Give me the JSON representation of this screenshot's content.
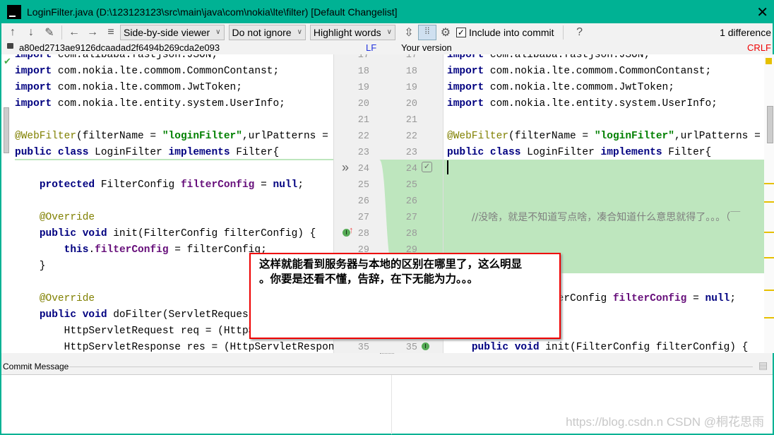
{
  "window": {
    "title": "LoginFilter.java (D:\\123123123\\src\\main\\java\\com\\nokia\\lte\\filter) [Default Changelist]",
    "logo": "IJ"
  },
  "toolbar": {
    "viewer": "Side-by-side viewer",
    "ignore": "Do not ignore",
    "highlight": "Highlight words",
    "include_label": "Include into commit",
    "include_checked": true,
    "help": "?",
    "differences": "1 difference"
  },
  "info": {
    "left_revision": "a80ed2713ae9126dcaadad2f6494b269cda2e093",
    "left_separator": "LF",
    "right_title": "Your version",
    "right_separator": "CRLF"
  },
  "left_lines": [
    {
      "n": "17",
      "t": [
        [
          "import",
          "kw"
        ],
        [
          " com.alibaba.fastjson.JSON;",
          ""
        ]
      ]
    },
    {
      "n": "18",
      "t": [
        [
          "import",
          "kw"
        ],
        [
          " com.nokia.lte.commom.CommonContanst;",
          ""
        ]
      ]
    },
    {
      "n": "19",
      "t": [
        [
          "import",
          "kw"
        ],
        [
          " com.nokia.lte.commom.JwtToken;",
          ""
        ]
      ]
    },
    {
      "n": "20",
      "t": [
        [
          "import",
          "kw"
        ],
        [
          " com.nokia.lte.entity.system.UserInfo;",
          ""
        ]
      ]
    },
    {
      "n": "21",
      "t": []
    },
    {
      "n": "22",
      "t": [
        [
          "@WebFilter",
          "ann"
        ],
        [
          "(filterName = ",
          ""
        ],
        [
          "\"loginFilter\"",
          "str"
        ],
        [
          ",urlPatterns = ",
          ""
        ],
        [
          "\"/",
          "str"
        ]
      ]
    },
    {
      "n": "23",
      "t": [
        [
          "public class",
          "kw"
        ],
        [
          " LoginFilter ",
          ""
        ],
        [
          "implements",
          "kw"
        ],
        [
          " Filter{",
          ""
        ]
      ]
    },
    {
      "n": "24",
      "t": []
    },
    {
      "n": "25",
      "t": [
        [
          "    ",
          ""
        ],
        [
          "protected",
          "kw"
        ],
        [
          " FilterConfig ",
          ""
        ],
        [
          "filterConfig",
          "fld"
        ],
        [
          " = ",
          ""
        ],
        [
          "null",
          "kw"
        ],
        [
          ";",
          ""
        ]
      ]
    },
    {
      "n": "26",
      "t": []
    },
    {
      "n": "27",
      "t": [
        [
          "    ",
          ""
        ],
        [
          "@Override",
          "ann"
        ]
      ]
    },
    {
      "n": "28",
      "t": [
        [
          "    ",
          ""
        ],
        [
          "public void",
          "kw"
        ],
        [
          " init(FilterConfig filterConfig) {",
          ""
        ]
      ]
    },
    {
      "n": "29",
      "t": [
        [
          "        ",
          ""
        ],
        [
          "this",
          "kw"
        ],
        [
          ".",
          ""
        ],
        [
          "filterConfig",
          "fld"
        ],
        [
          " = filterConfig;",
          ""
        ]
      ]
    },
    {
      "n": "30",
      "t": [
        [
          "    }",
          ""
        ]
      ]
    },
    {
      "n": "31",
      "t": []
    },
    {
      "n": "32",
      "t": [
        [
          "    ",
          ""
        ],
        [
          "@Override",
          "ann"
        ]
      ]
    },
    {
      "n": "33",
      "t": [
        [
          "    ",
          ""
        ],
        [
          "public void",
          "kw"
        ],
        [
          " doFilter(ServletRequest s",
          ""
        ]
      ]
    },
    {
      "n": "34",
      "t": [
        [
          "        HttpServletRequest req = (HttpServ",
          ""
        ]
      ]
    },
    {
      "n": "35",
      "t": [
        [
          "        HttpServletResponse res = (HttpServletResponse)",
          ""
        ]
      ]
    }
  ],
  "right_lines": [
    {
      "n": "17",
      "t": [
        [
          "import",
          "kw"
        ],
        [
          " com.alibaba.fastjson.JSON;",
          ""
        ]
      ]
    },
    {
      "n": "18",
      "t": [
        [
          "import",
          "kw"
        ],
        [
          " com.nokia.lte.commom.CommonContanst;",
          ""
        ]
      ]
    },
    {
      "n": "19",
      "t": [
        [
          "import",
          "kw"
        ],
        [
          " com.nokia.lte.commom.JwtToken;",
          ""
        ]
      ]
    },
    {
      "n": "20",
      "t": [
        [
          "import",
          "kw"
        ],
        [
          " com.nokia.lte.entity.system.UserInfo;",
          ""
        ]
      ]
    },
    {
      "n": "21",
      "t": []
    },
    {
      "n": "22",
      "t": [
        [
          "@WebFilter",
          "ann"
        ],
        [
          "(filterName = ",
          ""
        ],
        [
          "\"loginFilter\"",
          "str"
        ],
        [
          ",urlPatterns = ",
          ""
        ],
        [
          "\"/*",
          "str"
        ]
      ]
    },
    {
      "n": "23",
      "t": [
        [
          "public class",
          "kw"
        ],
        [
          " LoginFilter ",
          ""
        ],
        [
          "implements",
          "kw"
        ],
        [
          " Filter{",
          ""
        ]
      ]
    },
    {
      "n": "24",
      "t": []
    },
    {
      "n": "25",
      "t": []
    },
    {
      "n": "26",
      "t": []
    },
    {
      "n": "27",
      "t": [
        [
          "    ",
          ""
        ],
        [
          "//没啥，就是不知道写点啥，凑合知道什么意思就得了。。。（￣",
          "cmt"
        ]
      ]
    },
    {
      "n": "28",
      "t": []
    },
    {
      "n": "29",
      "t": []
    },
    {
      "n": "30",
      "t": []
    },
    {
      "n": "31",
      "t": []
    },
    {
      "n": "32",
      "t": [
        [
          "    ",
          ""
        ],
        [
          "protected",
          "kw"
        ],
        [
          " FilterConfig ",
          ""
        ],
        [
          "filterConfig",
          "fld"
        ],
        [
          " = ",
          ""
        ],
        [
          "null",
          "kw"
        ],
        [
          ";",
          ""
        ]
      ]
    },
    {
      "n": "33",
      "t": []
    },
    {
      "n": "34",
      "t": []
    },
    {
      "n": "35",
      "t": [
        [
          "    ",
          ""
        ],
        [
          "public void",
          "kw"
        ],
        [
          " init(FilterConfig filterConfig) {",
          ""
        ]
      ]
    }
  ],
  "callout": {
    "line1": "这样就能看到服务器与本地的区别在哪里了，这么明显",
    "line2": "。你要是还看不懂，告辞，在下无能为力。。。"
  },
  "commit": {
    "label": "Commit Message",
    "message": ""
  },
  "watermark": "https://blog.csdn.n  CSDN @桐花思雨",
  "colors": {
    "titlebar": "#00b294",
    "inserted": "#bee6be",
    "marker": "#e6c000"
  }
}
